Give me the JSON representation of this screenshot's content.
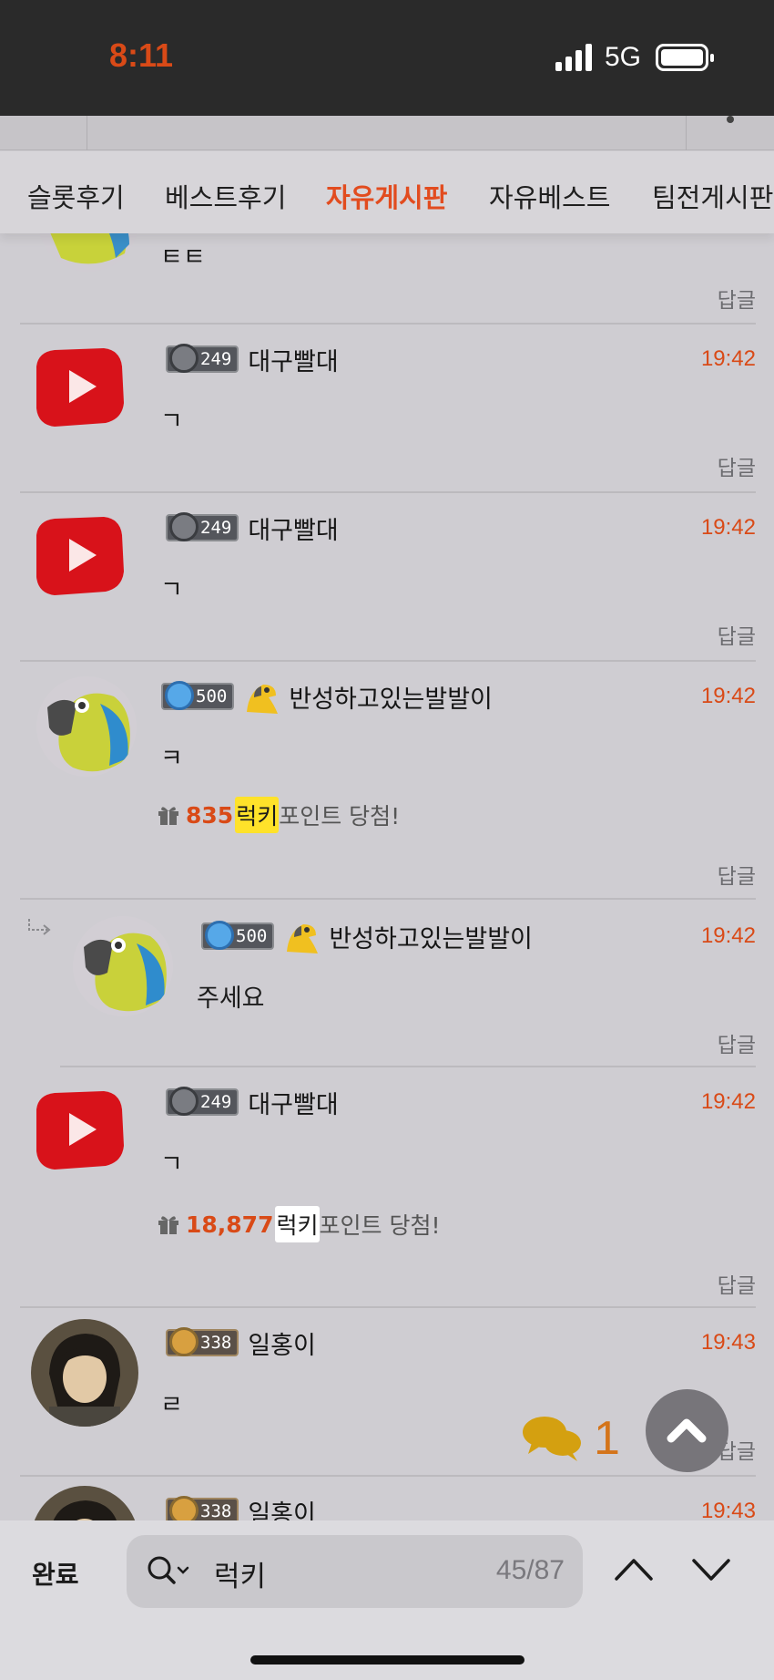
{
  "status_bar": {
    "time": "8:11",
    "network": "5G"
  },
  "tabs": [
    {
      "label": "슬롯후기",
      "active": false
    },
    {
      "label": "베스트후기",
      "active": false
    },
    {
      "label": "자유게시판",
      "active": true
    },
    {
      "label": "자유베스트",
      "active": false
    },
    {
      "label": "팀전게시판",
      "active": false
    }
  ],
  "comments": [
    {
      "body": "ㅌㅌ",
      "reply": "답글"
    },
    {
      "level": "249",
      "nick": "대구빨대",
      "time": "19:42",
      "body": "ㄱ",
      "reply": "답글"
    },
    {
      "level": "249",
      "nick": "대구빨대",
      "time": "19:42",
      "body": "ㄱ",
      "reply": "답글"
    },
    {
      "level": "500",
      "nick": "반성하고있는발발이",
      "time": "19:42",
      "body": "ㅋ",
      "lucky_points": "835",
      "lucky_word": "럭키",
      "lucky_suffix": "포인트 당첨!",
      "reply": "답글"
    },
    {
      "level": "500",
      "nick": "반성하고있는발발이",
      "time": "19:42",
      "body": "주세요",
      "reply": "답글"
    },
    {
      "level": "249",
      "nick": "대구빨대",
      "time": "19:42",
      "body": "ㄱ",
      "lucky_points": "18,877",
      "lucky_word": "럭키",
      "lucky_suffix": "포인트 당첨!",
      "reply": "답글"
    },
    {
      "level": "338",
      "nick": "일홍이",
      "time": "19:43",
      "body": "ㄹ",
      "reply": "답글"
    },
    {
      "level": "338",
      "nick": "일홍이",
      "time": "19:43"
    }
  ],
  "floating": {
    "comment_count": "1"
  },
  "find_bar": {
    "done_label": "완료",
    "query": "럭키",
    "count": "45/87"
  },
  "colors": {
    "accent": "#e24c1f",
    "time": "#d94a17",
    "highlight": "#ffe22a"
  }
}
